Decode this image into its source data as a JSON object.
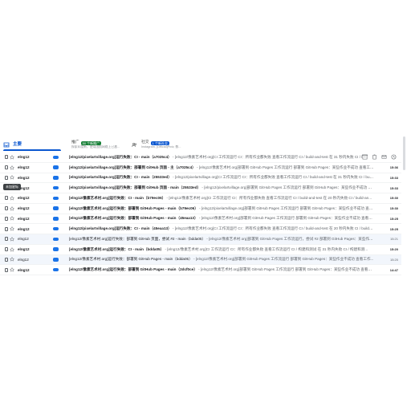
{
  "tabs": {
    "primary": {
      "label": "主要"
    },
    "promotions": {
      "label": "推广",
      "badge": "50 个新推广",
      "badge_color": "#188038",
      "sub": "探索印度新，使用国航网络上已激..."
    },
    "social": {
      "label": "社交",
      "badge": "1 个新社交",
      "badge_color": "#0b57d0",
      "sub": "Instagram, [Official]Pixiv, 数..."
    }
  },
  "tooltip": "未加星标",
  "accent_color": "#0b57d0",
  "emails": [
    {
      "sender": "elng12",
      "subject": "[elng12/pixelartvillage.org]运行失败：CI - main（a7025c4）",
      "snippet": " - [elng12/像素艺术村.org]CI 工作流运行 CI：所有作业都失败 查看工作流运行 CI / build-and-test 在 31 秒内失败 CI / build-and-test",
      "time": "15:36",
      "read": false,
      "hovered": true
    },
    {
      "sender": "elng12",
      "subject": "[elng12/pixelartvillage.org]运行失败：部署到 GitHub 页面 - 主（a7025c4）",
      "snippet": " - [elng12/像素艺术村.org]部署到 GitHub Pages 工作流运行 部署到 GitHub Pages：某些作业不成功 查看工作流运行",
      "time": "15:36",
      "read": false,
      "hovered": false
    },
    {
      "sender": "elng12",
      "subject": "[elng12/pixelartvillage.org]运行失败：CI - main（25533ed）",
      "snippet": " - [elng12/pixelartvillage.org]CI 工作流运行 CI：所有作业都失败 查看工作流运行 CI / build-and-test 在 31 秒内失败 CI / build-...",
      "time": "15:33",
      "read": false,
      "hovered": false
    },
    {
      "sender": "elng12",
      "subject": "[elng12/pixelartvillage.org]运行失败：部署到 GitHub 页面 - main（25533ed）",
      "snippet": " - [elng12/pixelartvillage.org]部署到 GitHub Pages 工作流运行 部署到 GitHub Pages：某些作业不成功 查看...",
      "time": "15:33",
      "read": false,
      "hovered": false
    },
    {
      "sender": "elng12",
      "subject": "[elng12/像素艺术村.org]运行失败：CI - main（b79ec06）",
      "snippet": " - [elng12/像素艺术村.org]CI 工作流运行 CI：所有作业都失败 查看工作流运行 CI / build-and-test 在 20 秒内失败 CI / build-an...",
      "time": "15:30",
      "read": false,
      "hovered": false
    },
    {
      "sender": "elng12",
      "subject": "[elng12/像素艺术村.org]运行失败：部署到 GitHub Pages - main（b79ec06）",
      "snippet": " - [elng12/pixelartvillage.org]部署到 GitHub Pages 工作流运行 部署到 GitHub Pages：某些作业不成功 查看工作流...",
      "time": "15:30",
      "read": false,
      "hovered": false
    },
    {
      "sender": "elng12",
      "subject": "[elng12/像素艺术村.org]运行失败：部署到 GitHub Pages - main（45eaa13）",
      "snippet": " - [elng12/像素艺术村.org]部署到 GitHub Pages 工作流运行 部署到 GitHub Pages：某些作业不成功 查看工作流...",
      "time": "15:25",
      "read": false,
      "hovered": false
    },
    {
      "sender": "elng12",
      "subject": "[elng12/pixelartvillage.org]运行失败：CI - main（45eaa13）",
      "snippet": " - [elng12/像素艺术村.org]CI 工作流运行 CI：所有作业都失败 查看工作流运行 CI / build-and-test 在 20 秒内失败 CI / build-and-tes...",
      "time": "15:25",
      "read": false,
      "hovered": false
    },
    {
      "sender": "elng12",
      "subject": "[elng12/像素艺术村.org]运行失败：部署到 GitHub 页面，尝试 #2 - main（bdda05）",
      "snippet": " - [elng12/像素艺术村.org]部署到 GitHub Pages 工作流运行，尝试 #2 部署到 GitHub Pages：某些作业#2：...",
      "time": "15:21",
      "read": true,
      "hovered": false
    },
    {
      "sender": "elng12",
      "subject": "[elng12/像素艺术村.org]运行失败：CI - main（bdda05）",
      "snippet": " - [elng12/像素艺术村.org]CI 工作流运行 CI：所有作业都失败 查看工作流运行 CI / 构建和测试 在 31 秒内失败 CI / 构建和测...",
      "time": "15:20",
      "read": false,
      "hovered": false
    },
    {
      "sender": "elng12",
      "subject": "[elng12/像素艺术村.org]运行失败：部署到 GitHub Pages - main（bdda05）",
      "snippet": " - [elng12/像素艺术村.org]部署到 GitHub Pages 工作流运行 部署到 GitHub Pages：某些作业不成功 查看工作...",
      "time": "15:20",
      "read": true,
      "hovered": false
    },
    {
      "sender": "elng12",
      "subject": "[elng12/像素艺术村.org]运行失败：部署到 GitHub Pages - main（2dcf0ce）",
      "snippet": " - [elng12/像素艺术村.org]部署到 GitHub Pages 工作流运行 部署到 GitHub Pages：某些作业不成功 查看工作流...",
      "time": "14:47",
      "read": false,
      "hovered": false
    }
  ]
}
